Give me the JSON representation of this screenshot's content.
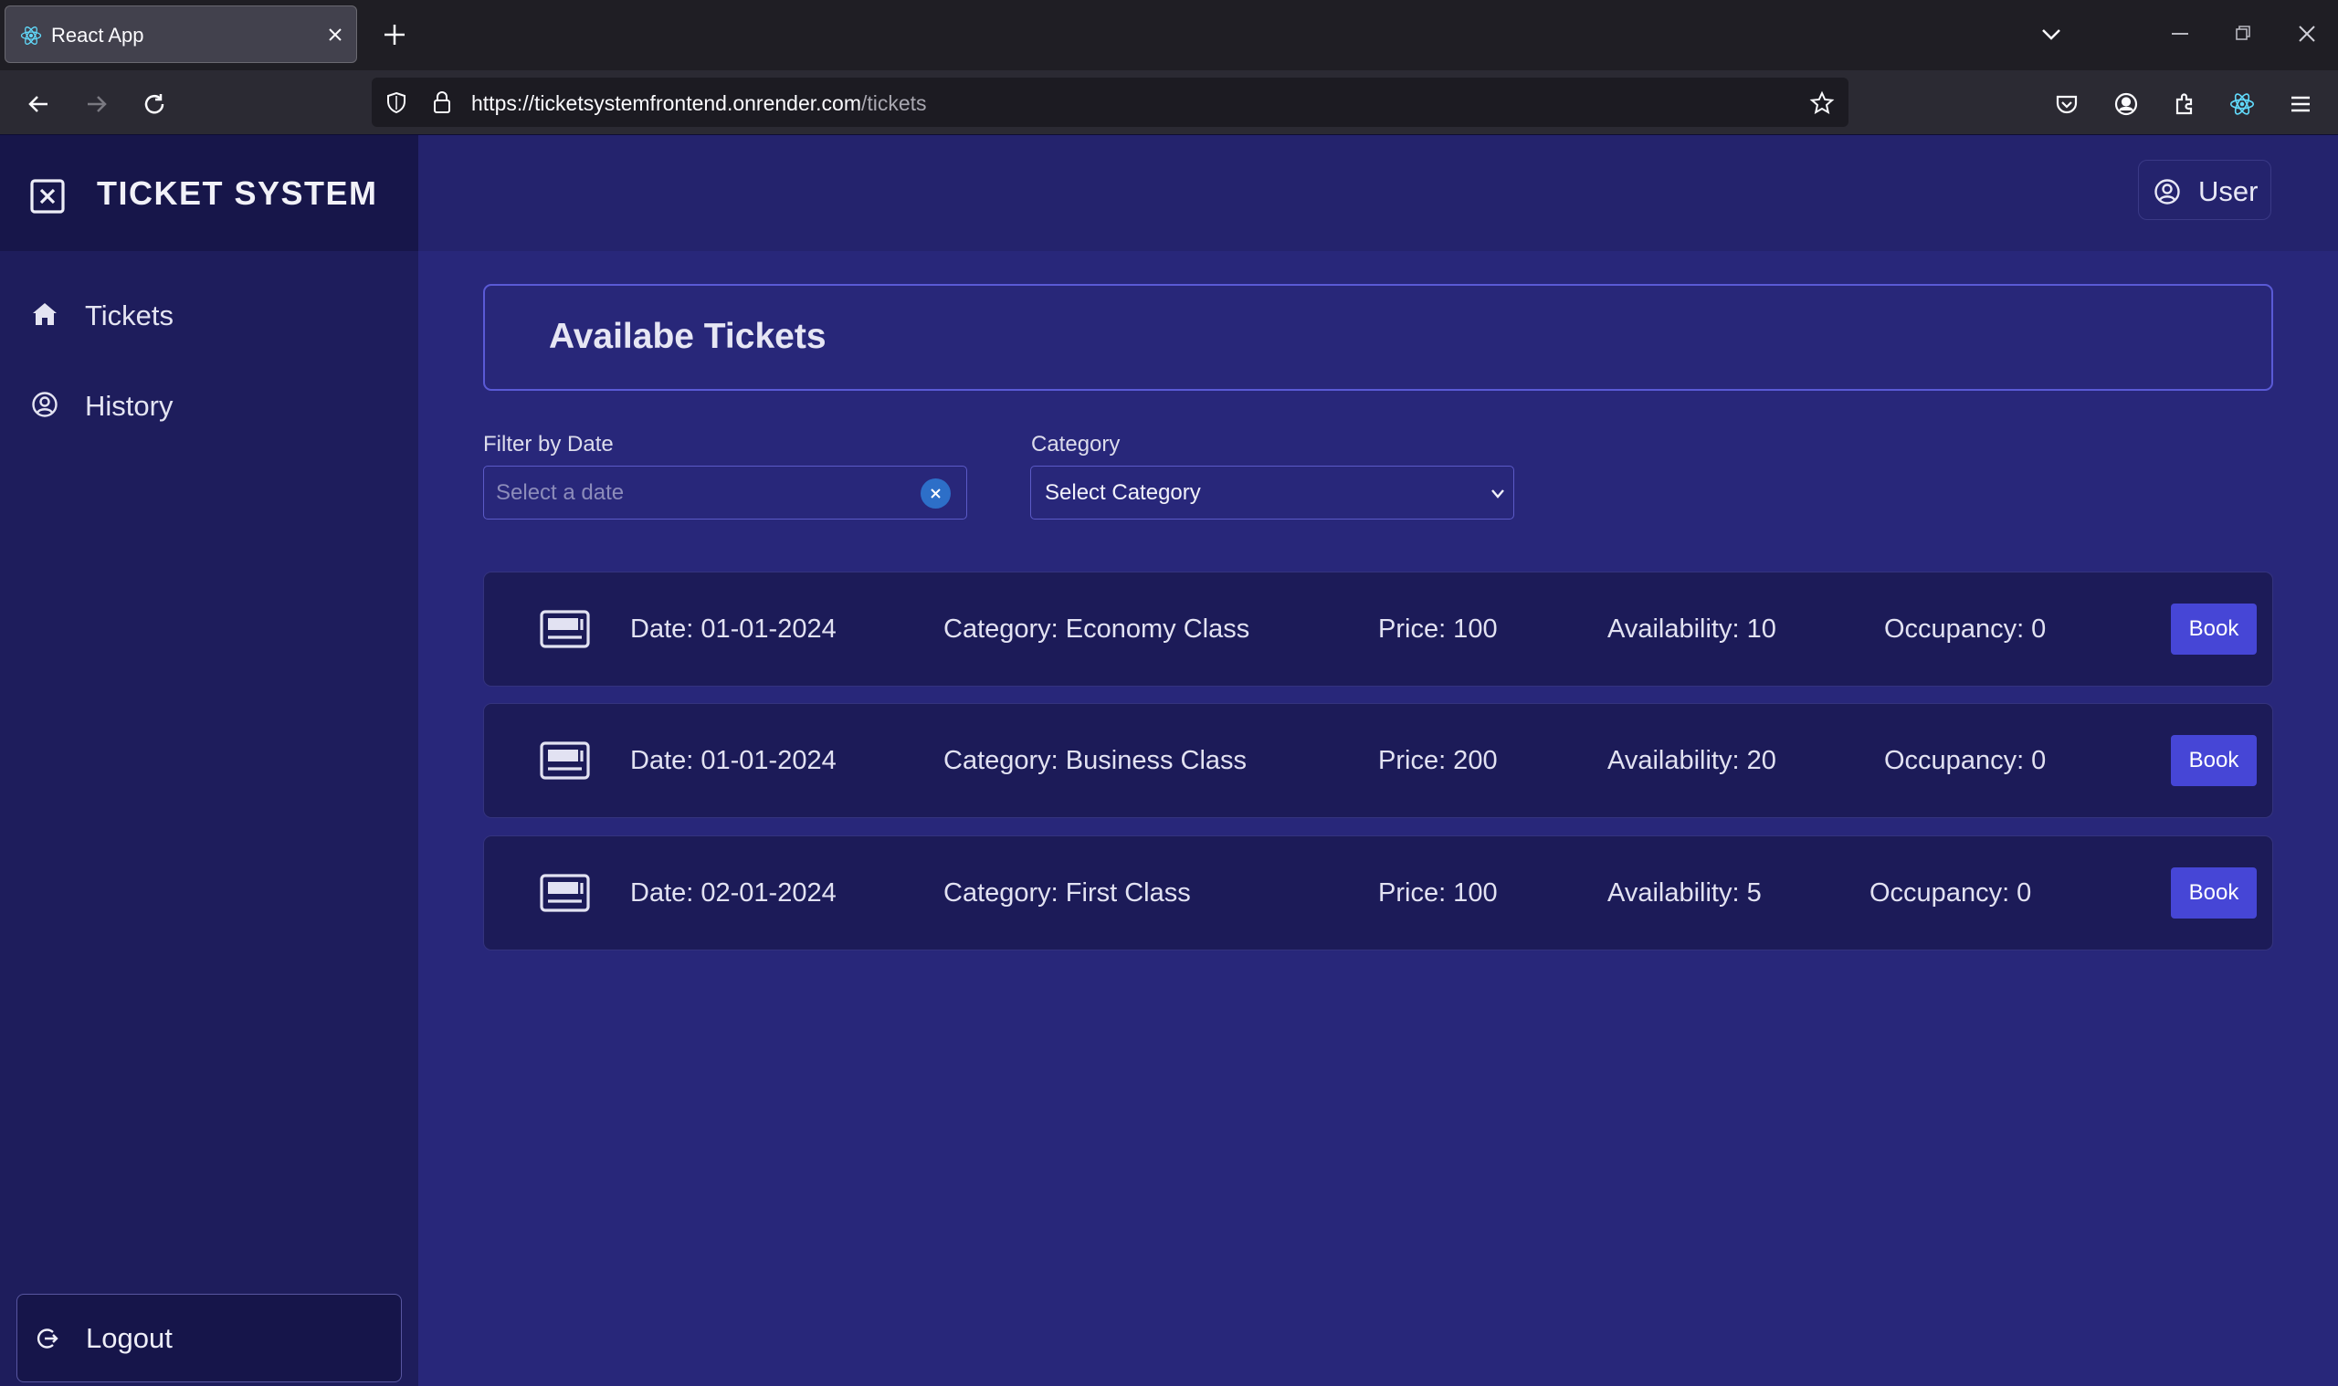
{
  "browser": {
    "tab_title": "React App",
    "url_host": "https://ticketsystemfrontend.onrender.com",
    "url_path": "/tickets"
  },
  "sidebar": {
    "brand": "TICKET SYSTEM",
    "items": [
      {
        "label": "Tickets",
        "icon": "home-icon"
      },
      {
        "label": "History",
        "icon": "user-circle-icon"
      }
    ],
    "logout_label": "Logout"
  },
  "header": {
    "user_label": "User"
  },
  "main": {
    "title": "Availabe Tickets",
    "filter_date_label": "Filter by Date",
    "date_placeholder": "Select a date",
    "category_label": "Category",
    "category_selected": "Select Category"
  },
  "tickets": [
    {
      "date": "Date: 01-01-2024",
      "category": "Category: Economy Class",
      "price": "Price: 100",
      "availability": "Availability: 10",
      "occupancy": "Occupancy: 0",
      "book": "Book"
    },
    {
      "date": "Date: 01-01-2024",
      "category": "Category: Business Class",
      "price": "Price: 200",
      "availability": "Availability: 20",
      "occupancy": "Occupancy: 0",
      "book": "Book"
    },
    {
      "date": "Date: 02-01-2024",
      "category": "Category: First Class",
      "price": "Price: 100",
      "availability": "Availability: 5",
      "occupancy": "Occupancy: 0",
      "book": "Book"
    }
  ],
  "colors": {
    "main_bg": "#28277a",
    "sidebar_bg": "#1e1d5c",
    "accent": "#4646d6",
    "ticket_bg": "#1c1b58"
  }
}
